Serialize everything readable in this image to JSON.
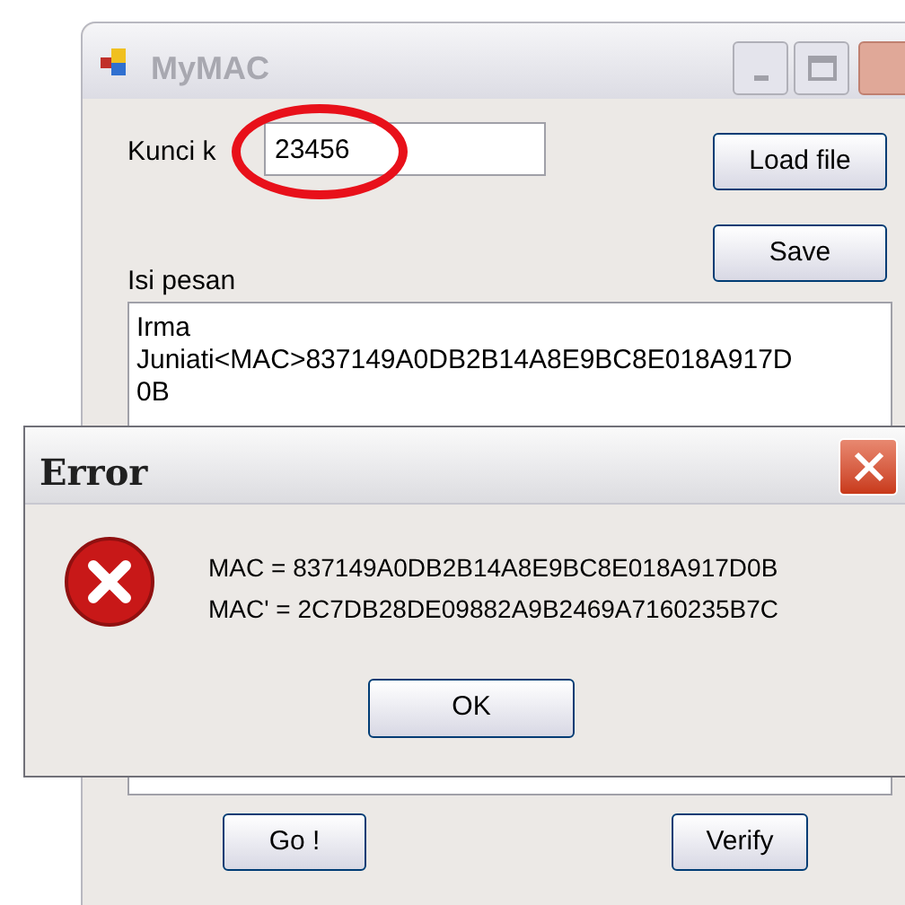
{
  "window": {
    "title": "MyMAC"
  },
  "key_label": "Kunci k",
  "key_field": {
    "value": "23456",
    "highlighted": true
  },
  "buttons_right": [
    "Load file",
    "Save"
  ],
  "message_label": "Isi pesan",
  "message_lines": [
    "Irma",
    "Juniati<MAC>837149A0DB2B14A8E9BC8E018A917D",
    "0B"
  ],
  "buttons_bottom": [
    "Go !",
    "Verify"
  ],
  "dialog": {
    "title": "Error",
    "lines": [
      "MAC = 837149A0DB2B14A8E9BC8E018A917D0B",
      "MAC' = 2C7DB28DE09882A9B2469A7160235B7C"
    ],
    "button": "OK"
  }
}
